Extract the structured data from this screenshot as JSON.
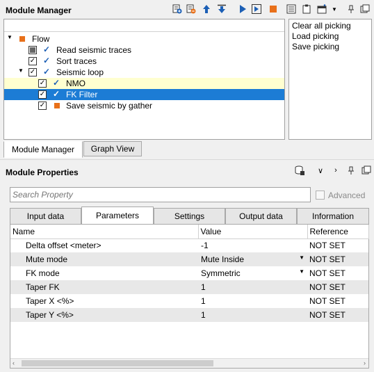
{
  "module_manager": {
    "title": "Module Manager",
    "toolbar_icons": [
      "add-module-icon",
      "remove-module-icon",
      "move-up-icon",
      "move-down-icon",
      "run-icon",
      "run-step-icon",
      "stop-icon",
      "list-icon",
      "clipboard-icon",
      "window-icon",
      "dropdown-icon",
      "pin-icon",
      "restore-icon"
    ],
    "tree": {
      "root": "Flow",
      "items": [
        {
          "label": "Read seismic traces",
          "state": "partial",
          "marker": "tick"
        },
        {
          "label": "Sort traces",
          "state": "checked",
          "marker": "tick"
        },
        {
          "label": "Seismic loop",
          "state": "checked",
          "marker": "tick"
        },
        {
          "label": "NMO",
          "state": "checked",
          "marker": "tick"
        },
        {
          "label": "FK Filter",
          "state": "checked",
          "marker": "tick"
        },
        {
          "label": "Save seismic by gather",
          "state": "checked",
          "marker": "orange-square"
        }
      ]
    },
    "context_actions": [
      "Clear all picking",
      "Load picking",
      "Save picking"
    ],
    "tabs": [
      "Module Manager",
      "Graph View"
    ]
  },
  "module_properties": {
    "title": "Module Properties",
    "search_placeholder": "Search Property",
    "advanced_label": "Advanced",
    "tabs": [
      "Input data",
      "Parameters",
      "Settings",
      "Output data",
      "Information"
    ],
    "columns": [
      "Name",
      "Value",
      "Reference"
    ],
    "rows": [
      {
        "name": "Delta offset <meter>",
        "value": "-1",
        "reference": "NOT SET"
      },
      {
        "name": "Mute mode",
        "value": "Mute Inside",
        "reference": "NOT SET"
      },
      {
        "name": "FK mode",
        "value": "Symmetric",
        "reference": "NOT SET"
      },
      {
        "name": "Taper FK",
        "value": "1",
        "reference": "NOT SET"
      },
      {
        "name": "Taper X <%>",
        "value": "1",
        "reference": "NOT SET"
      },
      {
        "name": "Taper Y <%>",
        "value": "1",
        "reference": "NOT SET"
      }
    ]
  },
  "colors": {
    "selection": "#1c7cd5",
    "highlight": "#ffffd0",
    "accent": "#1c5fb5",
    "orange": "#e8701a"
  }
}
